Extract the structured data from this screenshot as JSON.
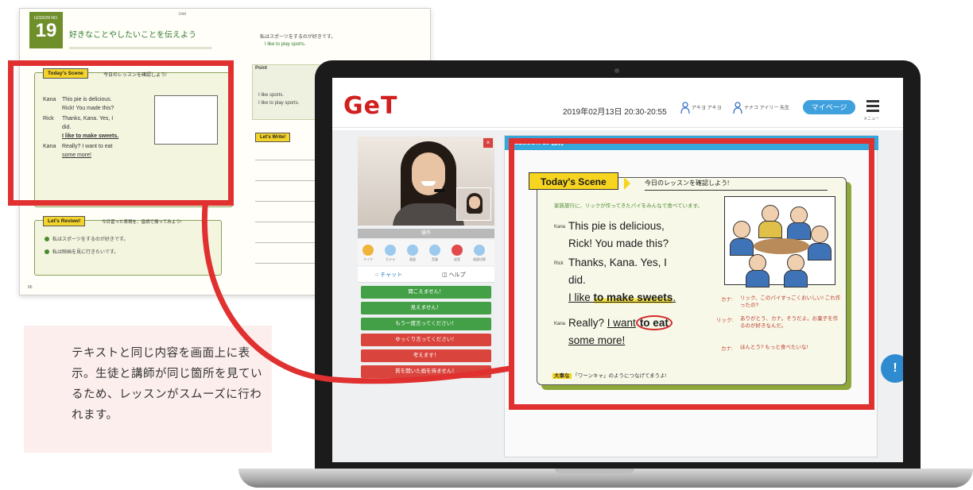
{
  "textbook": {
    "unit_label": "Unit",
    "lesson_label": "LESSON NO.",
    "lesson_number": "19",
    "page_title": "好きなことやしたいことを伝えよう",
    "scene_tag": "Today's Scene",
    "scene_sub": "今日のレッスンを確認しよう!",
    "dialog": [
      {
        "speaker": "Kana",
        "text": "This pie is delicious."
      },
      {
        "speaker": "",
        "text": "Rick! You made this?"
      },
      {
        "speaker": "Rick",
        "text": "Thanks, Kana. Yes, I"
      },
      {
        "speaker": "",
        "text": "did."
      },
      {
        "speaker": "",
        "text": "I like to make sweets."
      },
      {
        "speaker": "Kana",
        "text": "Really? I want to eat"
      },
      {
        "speaker": "",
        "text": "some more!"
      }
    ],
    "review_tag": "Let's Review!",
    "review_sub": "今日習った表現を、音読で振ってみよう!",
    "review_lines": [
      "私はスポーツをするのが好きです。",
      "私は映画を見に行きたいです。"
    ],
    "right_intro": "私はスポーツをするのが好きです。",
    "right_example": "I like to play sports.",
    "point_label": "Point",
    "write_tag": "Let's Write!",
    "sample_lines": [
      "I like sports.",
      "I like to play sports."
    ],
    "page_number": "86"
  },
  "screen": {
    "logo": "GeT",
    "datetime": "2019年02月13日 20:30-20:55",
    "teacher_1": "アキヨ アキヨ",
    "teacher_2": "ナナコ アイリー 先生",
    "mypage_label": "マイページ",
    "menu_label": "メニュー",
    "video": {
      "close_label": "×"
    },
    "ops_title": "操作",
    "ops_buttons": [
      "マイク",
      "カメラ",
      "画面",
      "音量",
      "退室",
      "画面切替"
    ],
    "tab_chat": "チャット",
    "tab_help": "ヘルプ",
    "message_buttons": [
      {
        "label": "聞こえません！",
        "color": "green"
      },
      {
        "label": "見えません！",
        "color": "green"
      },
      {
        "label": "もう一度言ってください！",
        "color": "green"
      },
      {
        "label": "ゆっくり言ってください！",
        "color": "red"
      },
      {
        "label": "考えます！",
        "color": "red"
      },
      {
        "label": "質を開いた画を待ません！",
        "color": "red"
      }
    ],
    "material": {
      "header": "LESSON 19 教材",
      "scene_tag": "Today's Scene",
      "scene_sub": "今日のレッスンを確認しよう!",
      "intro": "家族旅行に、リックが作ってきたパイをみんなで食べています。",
      "dialog": [
        {
          "speaker": "Kana",
          "lines": [
            "This pie is delicious,",
            "Rick! You made this?"
          ]
        },
        {
          "speaker": "Rick",
          "lines": [
            "Thanks, Kana.  Yes, I",
            "did.",
            "I like to make sweets."
          ]
        },
        {
          "speaker": "Kana",
          "lines": [
            "Really? I want to eat",
            "some more!"
          ]
        }
      ],
      "line_want_prefix": "Really? ",
      "line_want": "I want",
      "line_toeat": "to eat",
      "line_make_a": "I like ",
      "line_make_b": "to make sweets",
      "line_make_c": ".",
      "translations": [
        {
          "speaker": "カナ:",
          "text": "リック、このパイすっごくおいしい! これ作ったの?"
        },
        {
          "speaker": "リック:",
          "text": "ありがとう、カナ。そうだよ。お菓子を作るのが好きなんだ。"
        },
        {
          "speaker": "カナ:",
          "text": "ほんとう? もっと食べたいな!"
        }
      ],
      "footnote_tag": "大事な",
      "footnote": "「ワーンキャ」のようにつなげてまうよ!"
    },
    "help_label": "!"
  },
  "callout": {
    "text": "テキストと同じ内容を画面上に表示。生徒と講師が同じ箇所を見ているため、レッスンがスムーズに行われます。"
  },
  "colors": {
    "highlight_red": "#e03030",
    "brand_red": "#d21f1f",
    "accent_blue": "#3fa0de",
    "green": "#43a047"
  }
}
